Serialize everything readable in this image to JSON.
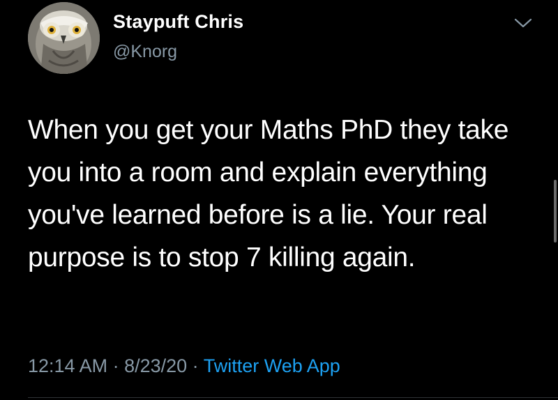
{
  "user": {
    "display_name": "Staypuft Chris",
    "handle": "@Knorg",
    "avatar_icon": "owl-avatar"
  },
  "menu": {
    "icon": "chevron-down-icon"
  },
  "tweet": {
    "text": "When you get your Maths PhD they take you into a room and explain everything you've learned before is a lie. Your real purpose is to stop 7 killing again."
  },
  "meta": {
    "time": "12:14 AM",
    "separator_1": " · ",
    "date": "8/23/20",
    "separator_2": " · ",
    "source": "Twitter Web App"
  },
  "colors": {
    "background": "#000000",
    "text": "#ffffff",
    "secondary": "#8899a6",
    "link": "#1da1f2"
  }
}
